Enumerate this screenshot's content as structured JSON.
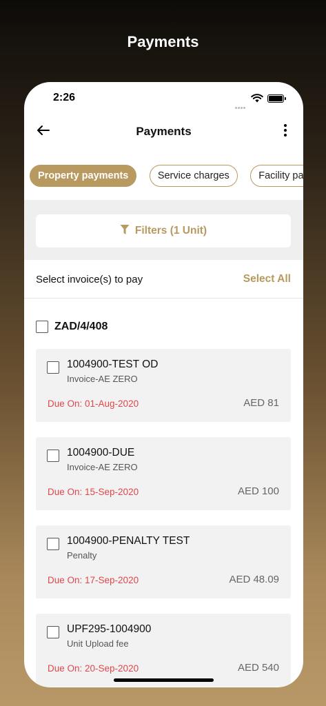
{
  "hero": {
    "title": "Payments"
  },
  "status_bar": {
    "time": "2:26"
  },
  "header": {
    "title": "Payments",
    "back_icon": "arrow-left-icon",
    "more_icon": "more-vertical-icon"
  },
  "tabs": [
    {
      "label": "Property payments",
      "active": true
    },
    {
      "label": "Service charges",
      "active": false
    },
    {
      "label": "Facility payments",
      "active": false
    }
  ],
  "filters": {
    "label": "Filters (1 Unit)",
    "icon": "funnel-icon"
  },
  "selection": {
    "prompt": "Select invoice(s) to pay",
    "select_all": "Select All"
  },
  "group": {
    "unit": "ZAD/4/408"
  },
  "invoices": [
    {
      "id": "1004900-TEST OD",
      "type": "Invoice-AE ZERO",
      "due": "Due On: 01-Aug-2020",
      "amount": "AED 81"
    },
    {
      "id": "1004900-DUE",
      "type": "Invoice-AE ZERO",
      "due": "Due On: 15-Sep-2020",
      "amount": "AED 100"
    },
    {
      "id": "1004900-PENALTY TEST",
      "type": "Penalty",
      "due": "Due On: 17-Sep-2020",
      "amount": "AED 48.09"
    },
    {
      "id": "UPF295-1004900",
      "type": "Unit Upload fee",
      "due": "Due On: 20-Sep-2020",
      "amount": "AED 540"
    }
  ],
  "colors": {
    "accent": "#b8995f",
    "due": "#e0464a",
    "card": "#f2f2f2"
  }
}
